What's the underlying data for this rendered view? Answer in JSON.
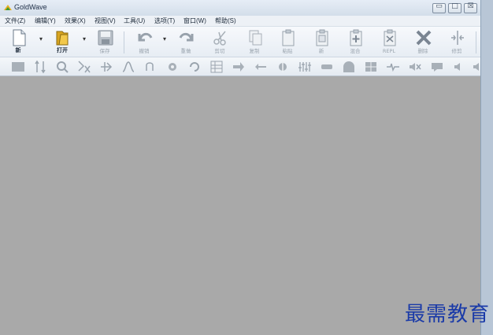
{
  "app": {
    "title": "GoldWave"
  },
  "window_controls": {
    "minimize": "▭",
    "maximize": "□",
    "close": "☒"
  },
  "menu": [
    "文件(Z)",
    "编辑(Y)",
    "效果(X)",
    "视图(V)",
    "工具(U)",
    "选项(T)",
    "窗口(W)",
    "帮助(S)"
  ],
  "toolbar": {
    "new": "新",
    "open": "打开",
    "save": "保存",
    "undo": "撤销",
    "redo": "重做",
    "cut": "剪切",
    "copy": "复制",
    "paste": "粘贴",
    "paste_new": "新",
    "mix": "混合",
    "replace": "REPL",
    "delete": "删除",
    "trim": "修剪"
  },
  "watermark": "最需教育"
}
